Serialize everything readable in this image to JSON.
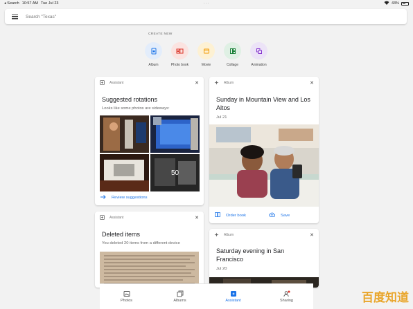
{
  "status": {
    "back_label": "◂ Search",
    "time": "10:57 AM",
    "date": "Tue Jul 23",
    "dots": "···",
    "battery": "43%"
  },
  "search": {
    "placeholder": "Search \"Texas\""
  },
  "create_new": {
    "label": "CREATE NEW",
    "items": [
      {
        "label": "Album",
        "icon": "album-icon",
        "bg": "#e3edfb",
        "color": "#1a73e8"
      },
      {
        "label": "Photo book",
        "icon": "photo-book-icon",
        "bg": "#fbe3e0",
        "color": "#d93025"
      },
      {
        "label": "Movie",
        "icon": "movie-icon",
        "bg": "#fdf1d3",
        "color": "#f29900"
      },
      {
        "label": "Collage",
        "icon": "collage-icon",
        "bg": "#dff0e4",
        "color": "#188038"
      },
      {
        "label": "Animation",
        "icon": "animation-icon",
        "bg": "#ece3f7",
        "color": "#8430ce"
      }
    ]
  },
  "cards": {
    "rotations": {
      "kind": "Assistant",
      "title": "Suggested rotations",
      "subtitle": "Looks like some photos are sideways:",
      "more_count": "50",
      "action": "Review suggestions"
    },
    "deleted": {
      "kind": "Assistant",
      "title": "Deleted items",
      "subtitle": "You deleted 20 items from a different device"
    },
    "sunday": {
      "kind": "Album",
      "title": "Sunday in Mountain View and Los Altos",
      "date": "Jul 21",
      "action_order": "Order book",
      "action_save": "Save"
    },
    "saturday": {
      "kind": "Album",
      "title": "Saturday evening in San Francisco",
      "date": "Jul 20"
    }
  },
  "nav": {
    "items": [
      {
        "label": "Photos",
        "icon": "photos-icon",
        "active": false
      },
      {
        "label": "Albums",
        "icon": "albums-icon",
        "active": false
      },
      {
        "label": "Assistant",
        "icon": "assistant-icon",
        "active": true
      },
      {
        "label": "Sharing",
        "icon": "sharing-icon",
        "active": false
      }
    ]
  },
  "watermark": "百度知道",
  "colors": {
    "accent": "#1a73e8",
    "background": "#f2f2f2",
    "card": "#ffffff"
  }
}
